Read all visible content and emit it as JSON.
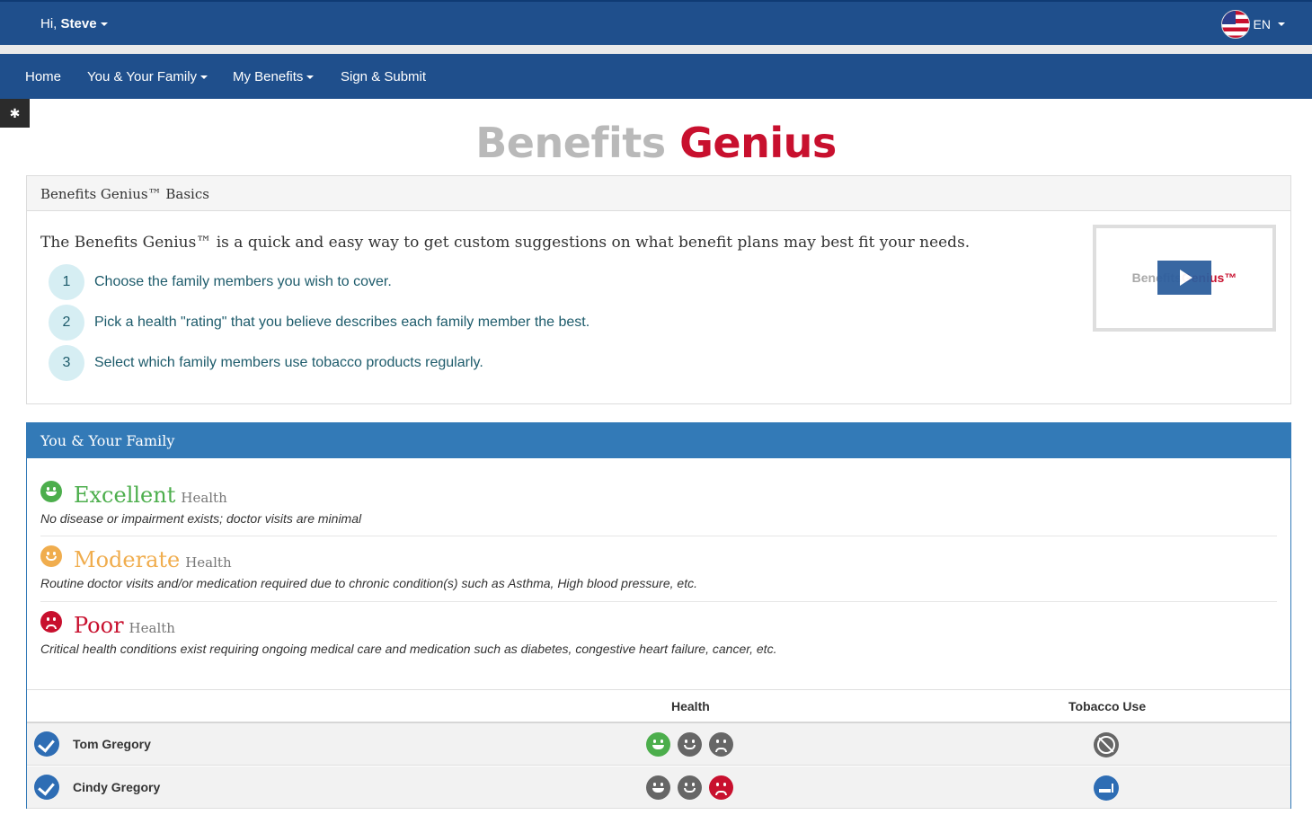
{
  "topbar": {
    "greeting_prefix": "Hi,",
    "user_name": "Steve",
    "language": "EN"
  },
  "nav": {
    "items": [
      {
        "label": "Home"
      },
      {
        "label": "You & Your Family"
      },
      {
        "label": "My Benefits"
      },
      {
        "label": "Sign & Submit"
      }
    ]
  },
  "logo": {
    "part1": "Benefits",
    "part2": "Genius"
  },
  "basics": {
    "title": "Benefits Genius™ Basics",
    "intro": "The Benefits Genius™ is a quick and easy way to get custom suggestions on what benefit plans may best fit your needs.",
    "steps": [
      {
        "num": "1",
        "text": "Choose the family members you wish to cover."
      },
      {
        "num": "2",
        "text": "Pick a health \"rating\" that you believe describes each family member the best."
      },
      {
        "num": "3",
        "text": "Select which family members use tobacco products regularly."
      }
    ],
    "video_logo": {
      "part1": "Benefits",
      "part2": "Genius™"
    }
  },
  "family": {
    "title": "You & Your Family",
    "ratings": [
      {
        "word": "Excellent",
        "sub": "Health",
        "desc": "No disease or impairment exists; doctor visits are minimal",
        "color": "#4cae4c",
        "icon": "grin-icon"
      },
      {
        "word": "Moderate",
        "sub": "Health",
        "desc": "Routine doctor visits and/or medication required due to chronic condition(s) such as Asthma, High blood pressure, etc.",
        "color": "#f0ad4e",
        "icon": "smile-icon"
      },
      {
        "word": "Poor",
        "sub": "Health",
        "desc": "Critical health conditions exist requiring ongoing medical care and medication such as diabetes, congestive heart failure, cancer, etc.",
        "color": "#c8102e",
        "icon": "frown-icon"
      }
    ],
    "columns": {
      "health": "Health",
      "tobacco": "Tobacco Use"
    },
    "members": [
      {
        "name": "Tom Gregory",
        "selected": true,
        "health": "Excellent",
        "tobacco": false
      },
      {
        "name": "Cindy Gregory",
        "selected": true,
        "health": "Poor",
        "tobacco": true
      }
    ]
  }
}
